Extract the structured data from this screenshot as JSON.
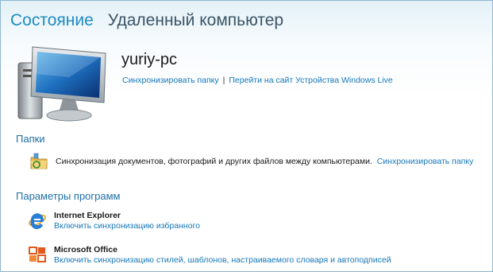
{
  "tabs": [
    {
      "label": "Состояние",
      "active": true
    },
    {
      "label": "Удаленный компьютер",
      "active": false
    }
  ],
  "device": {
    "name": "yuriy-pc",
    "links": [
      "Синхронизировать папку",
      "Перейти на сайт Устройства Windows Live"
    ],
    "separator": "|"
  },
  "folders": {
    "title": "Папки",
    "description": "Синхронизация документов, фотографий и других файлов между компьютерами.",
    "action": "Синхронизировать папку"
  },
  "programs": {
    "title": "Параметры программ",
    "items": [
      {
        "name": "Internet Explorer",
        "action": "Включить синхронизацию избранного",
        "icon": "internet-explorer-icon"
      },
      {
        "name": "Microsoft Office",
        "action": "Включить синхронизацию стилей, шаблонов, настраиваемого словаря и автоподписей",
        "icon": "microsoft-office-icon"
      }
    ]
  },
  "colors": {
    "accent": "#1e8bc3",
    "link": "#1577b8",
    "section": "#1e6fa5"
  }
}
